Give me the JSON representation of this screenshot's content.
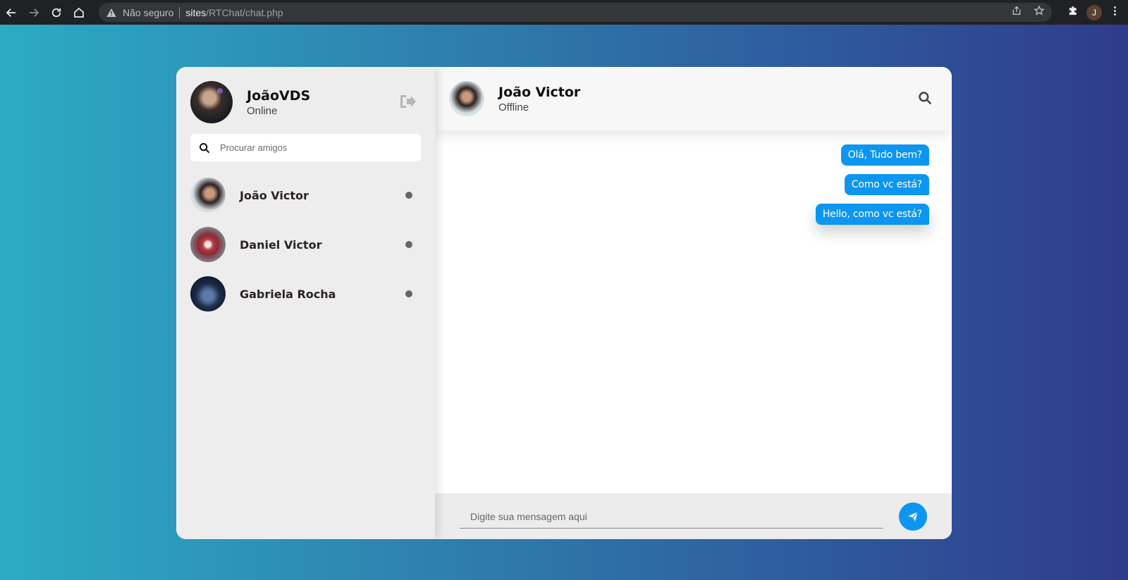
{
  "browser": {
    "security_label": "Não seguro",
    "url_host": "sites",
    "url_path": "/RTChat/chat.php",
    "profile_initial": "J"
  },
  "colors": {
    "accent": "#0c96f0",
    "gradient_start": "#2cabc4",
    "gradient_end": "#2f3b8d"
  },
  "current_user": {
    "name": "JoãoVDS",
    "status": "Online"
  },
  "search": {
    "placeholder": "Procurar amigos"
  },
  "friends": [
    {
      "name": "João Victor"
    },
    {
      "name": "Daniel Victor"
    },
    {
      "name": "Gabriela Rocha"
    }
  ],
  "chat": {
    "contact_name": "João Victor",
    "contact_status": "Offline",
    "messages": [
      "Olá, Tudo bem?",
      "Como vc está?",
      "Hello, como vc está?"
    ],
    "composer_placeholder": "Digite sua mensagem aqui"
  }
}
